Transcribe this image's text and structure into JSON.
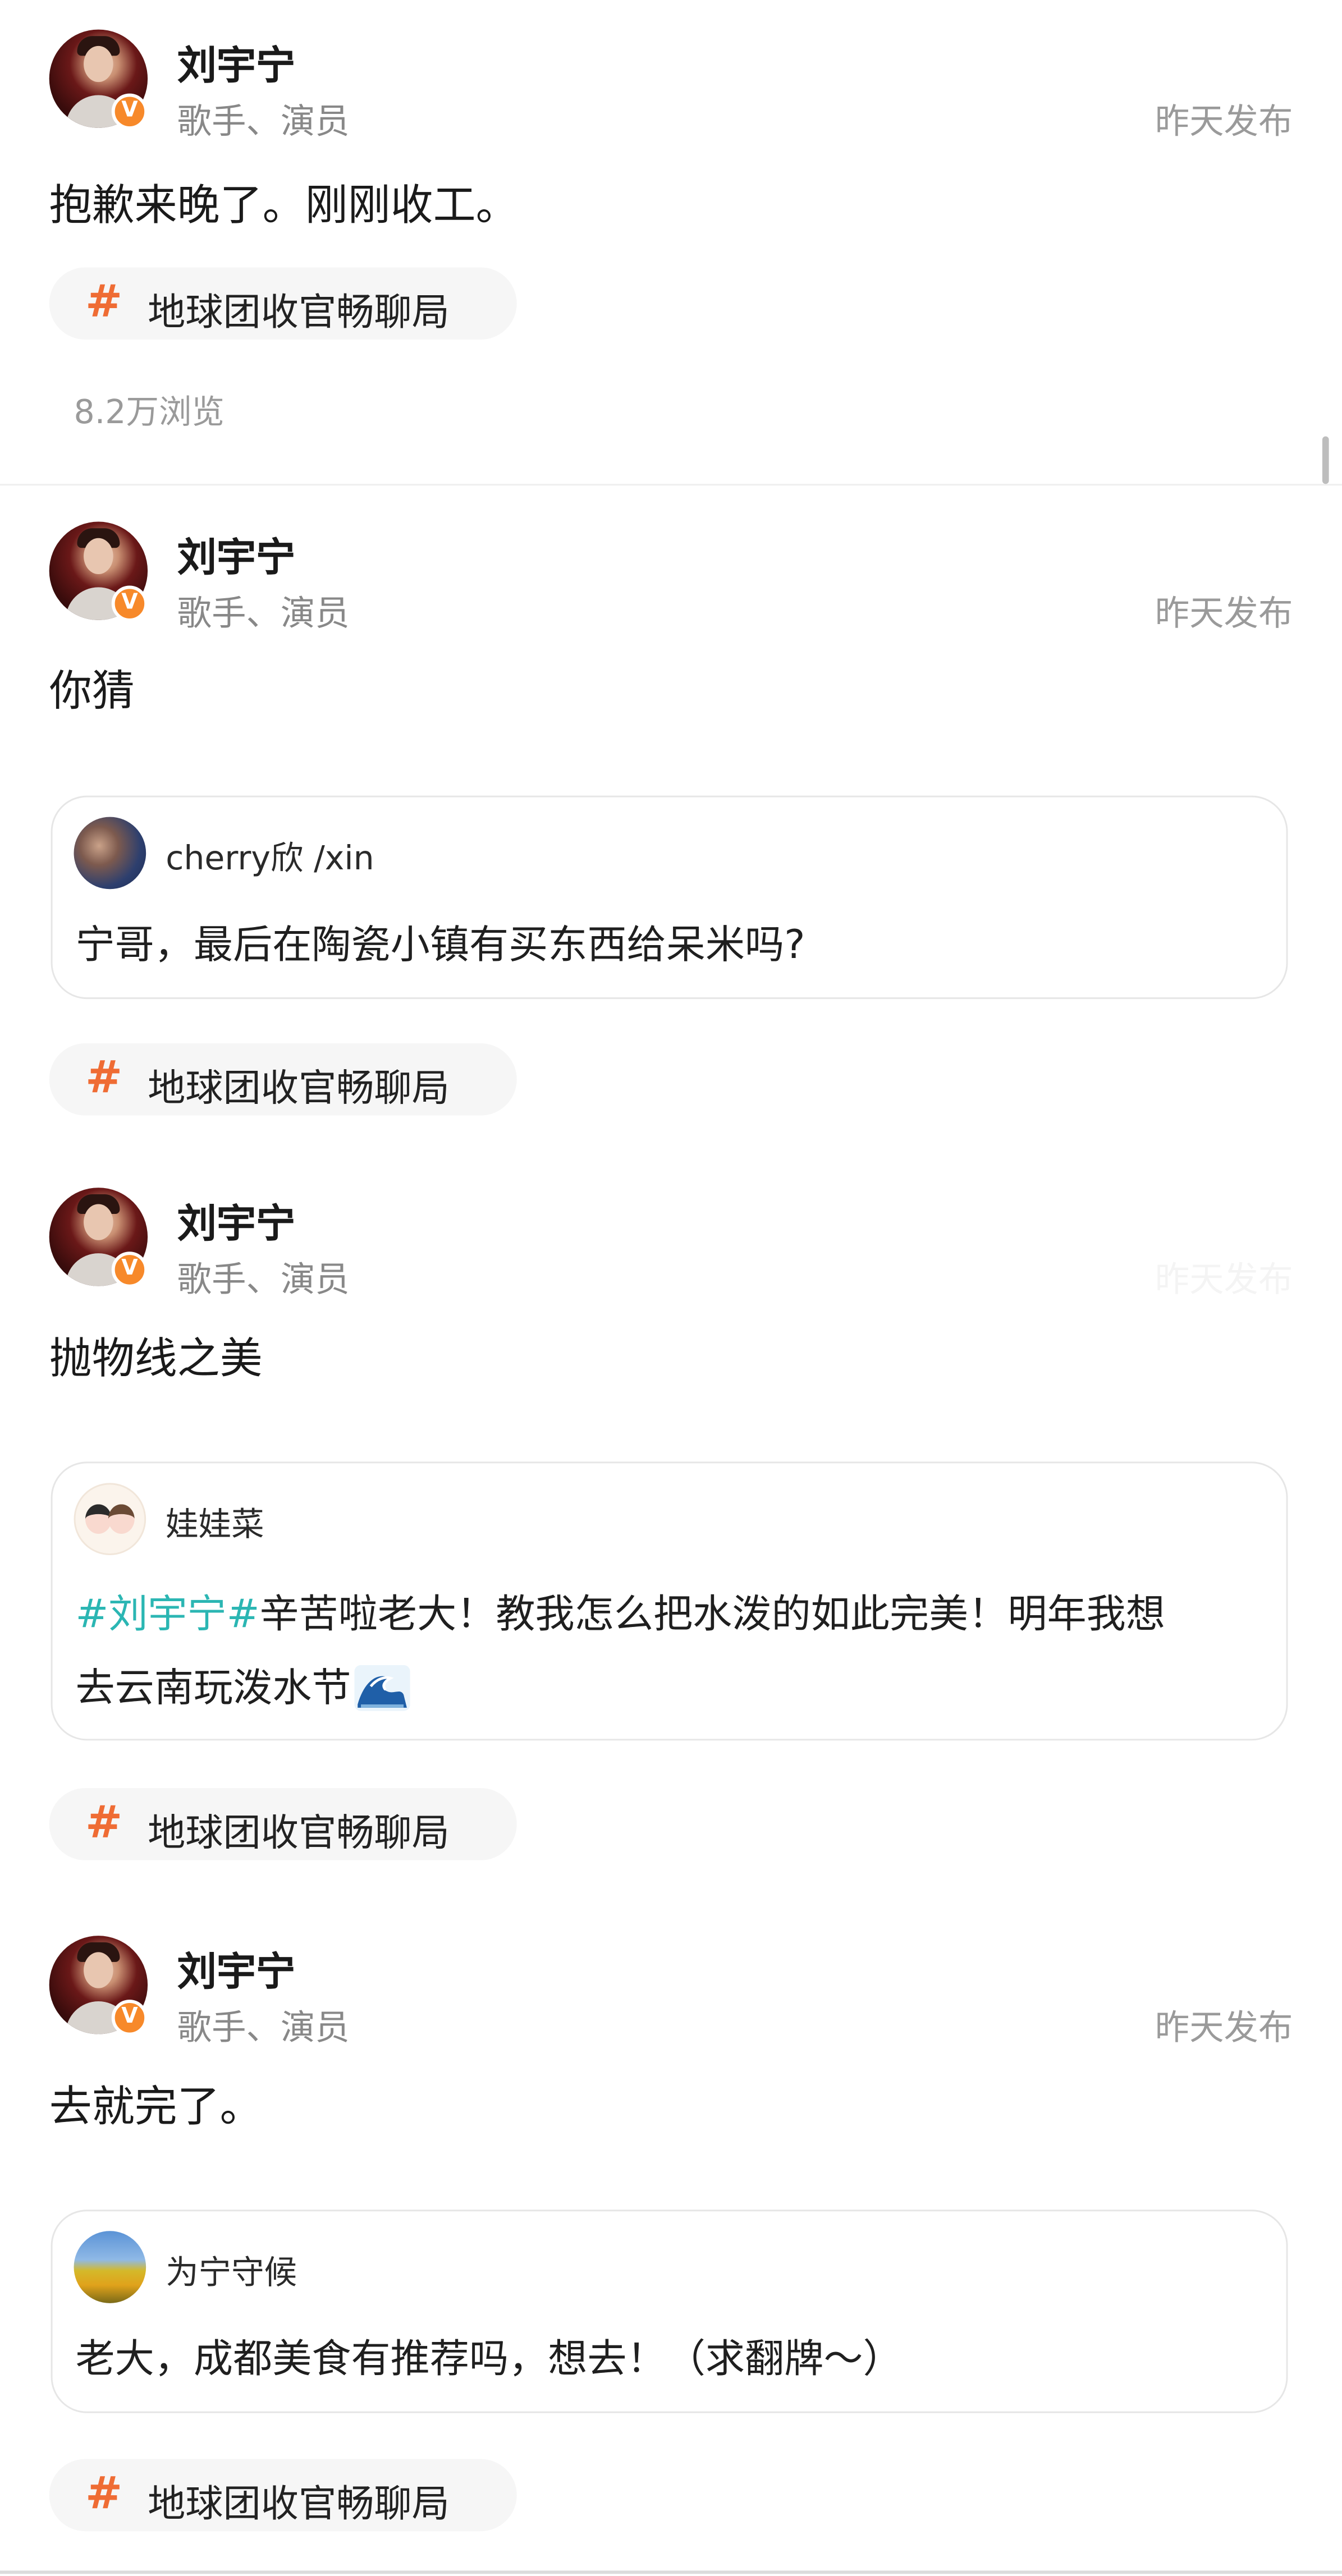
{
  "posts": [
    {
      "author": "刘宇宁",
      "desc": "歌手、演员",
      "time": "昨天发布",
      "text": "抱歉来晚了。刚刚收工。",
      "topic": "地球团收官畅聊局",
      "views": "8.2万浏览"
    },
    {
      "author": "刘宇宁",
      "desc": "歌手、演员",
      "time": "昨天发布",
      "text": "你猜",
      "quote": {
        "user": "cherry欣 /xin",
        "text": "宁哥，最后在陶瓷小镇有买东西给呆米吗?"
      },
      "topic": "地球团收官畅聊局"
    },
    {
      "author": "刘宇宁",
      "desc": "歌手、演员",
      "time": "昨天发布",
      "text": "抛物线之美",
      "quote": {
        "user": "娃娃菜",
        "mention": "#刘宇宁#",
        "text_line1": "辛苦啦老大！教我怎么把水泼的如此完美！明年我想",
        "text_line2": "去云南玩泼水节"
      },
      "topic": "地球团收官畅聊局"
    },
    {
      "author": "刘宇宁",
      "desc": "歌手、演员",
      "time": "昨天发布",
      "text": "去就完了。",
      "quote": {
        "user": "为宁守候",
        "text": "老大，成都美食有推荐吗，想去！（求翻牌～）"
      },
      "topic": "地球团收官畅聊局"
    }
  ],
  "icons": {
    "verified": "verified-v-icon",
    "topic": "hashtag-icon",
    "emoji": "water-wave-emoji"
  },
  "colors": {
    "accent": "#ef6c34",
    "verify": "#f7892a",
    "mention": "#2bb6b3",
    "secondary_text": "#888888"
  }
}
